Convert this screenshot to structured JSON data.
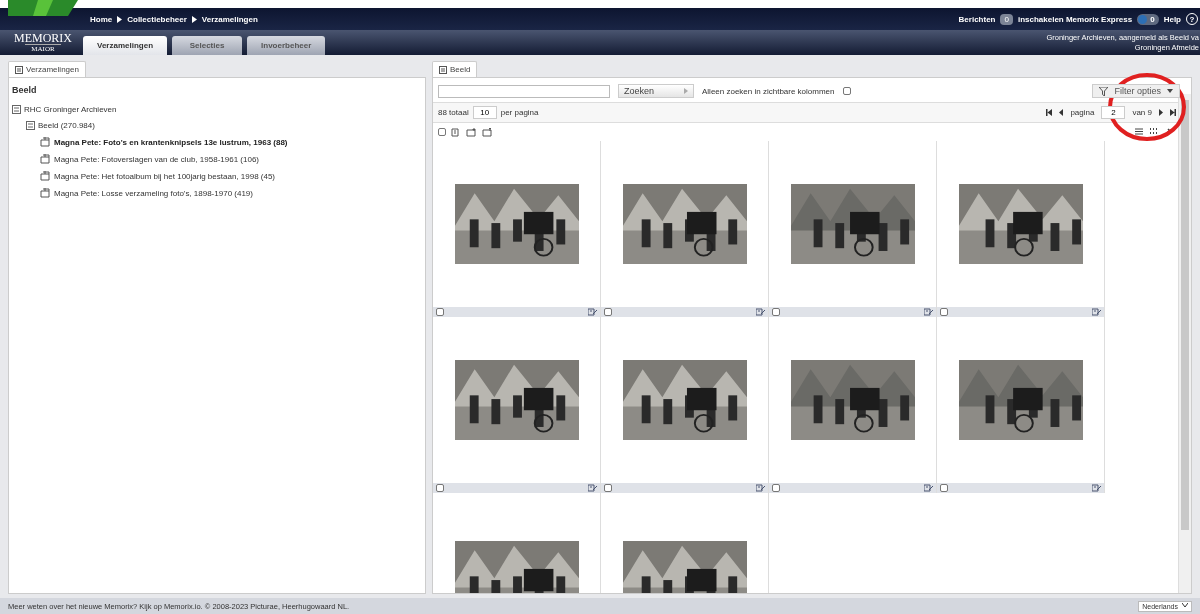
{
  "breadcrumb": [
    "Home",
    "Collectiebeheer",
    "Verzamelingen"
  ],
  "logo": {
    "name": "MEMORIX",
    "sub": "MAIOR"
  },
  "main_tabs": [
    {
      "label": "Verzamelingen",
      "selected": true
    },
    {
      "label": "Selecties",
      "selected": false
    },
    {
      "label": "Invoerbeheer",
      "selected": false
    }
  ],
  "top_right": {
    "messages_label": "Berichten",
    "messages_count": "0",
    "express_label": "inschakelen Memorix Express",
    "express_count": "0",
    "express_on": false,
    "help_label": "Help",
    "help_icon": "?"
  },
  "account": {
    "text": "Groninger Archieven, aangemeld als",
    "link_1": "Beeld va",
    "link_2": "Groningen",
    "logout": "Afmelde"
  },
  "left_panel": {
    "tab": "Verzamelingen",
    "heading": "Beeld",
    "tree": [
      {
        "label": "RHC Groninger Archieven",
        "expanded": true,
        "children": [
          {
            "label": "Beeld (270.984)",
            "expanded": true,
            "children": [
              {
                "label": "Magna Pete: Foto's en krantenknipsels 13e lustrum, 1963 (88)",
                "selected": true
              },
              {
                "label": "Magna Pete: Fotoverslagen van de club, 1958-1961 (106)",
                "selected": false
              },
              {
                "label": "Magna Pete: Het fotoalbum bij het 100jarig bestaan, 1998 (45)",
                "selected": false
              },
              {
                "label": "Magna Pete: Losse verzameling foto's, 1898-1970 (419)",
                "selected": false
              }
            ]
          }
        ]
      }
    ]
  },
  "right_panel": {
    "tab": "Beeld",
    "search": {
      "button": "Zoeken",
      "visible_only_label": "Alleen zoeken in zichtbare kolommen",
      "visible_only_checked": false
    },
    "filter_button": "Filter opties",
    "total": "88 totaal",
    "per_page": "10",
    "per_page_label": "per pagina",
    "page_label": "pagina",
    "page": "2",
    "page_of": "van 9",
    "select_all_checked": false
  },
  "annotation": {
    "kind": "ellipse",
    "color": "#e02020"
  },
  "footer": {
    "text_1": "Meer weten over het nieuwe Memorix? Kijk op",
    "link_1": "Memorix.io",
    "text_2": ". © 2008-2023",
    "link_2": "Picturae",
    "text_3": ", Heerhugowaard NL.",
    "language": "Nederlands"
  }
}
